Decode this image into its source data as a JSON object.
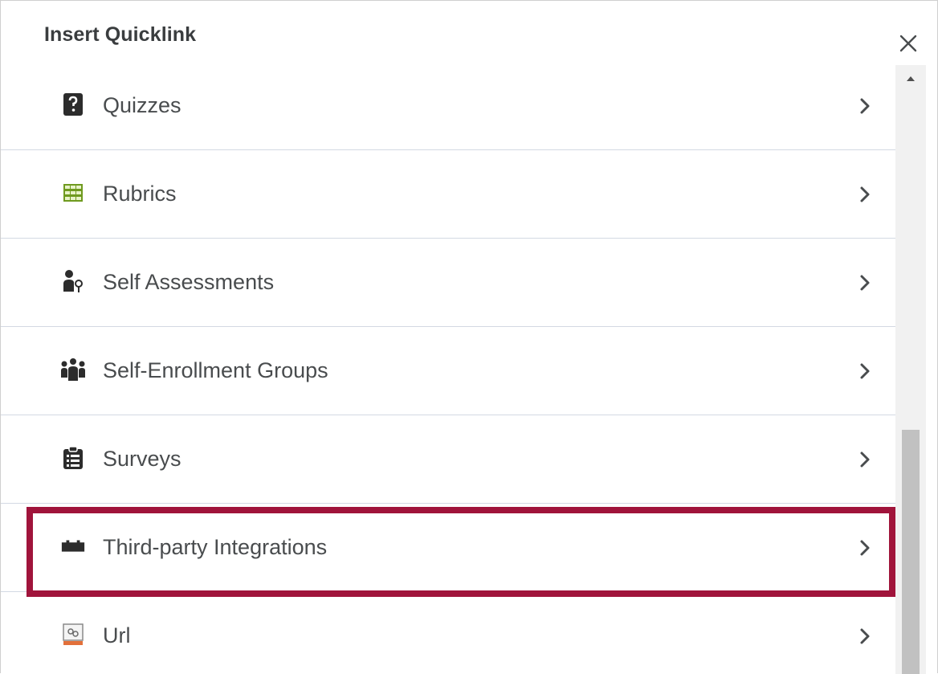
{
  "dialog": {
    "title": "Insert Quicklink",
    "close_icon": "close-icon"
  },
  "items": [
    {
      "label": "Quizzes",
      "icon": "quiz-icon"
    },
    {
      "label": "Rubrics",
      "icon": "rubric-icon"
    },
    {
      "label": "Self Assessments",
      "icon": "self-assessment-icon"
    },
    {
      "label": "Self-Enrollment Groups",
      "icon": "groups-icon"
    },
    {
      "label": "Surveys",
      "icon": "survey-icon"
    },
    {
      "label": "Third-party Integrations",
      "icon": "integrations-icon",
      "highlighted": true
    },
    {
      "label": "Url",
      "icon": "url-icon"
    }
  ],
  "colors": {
    "highlight": "#a0143b",
    "text": "#494c4e",
    "divider": "#d3d9e3"
  }
}
